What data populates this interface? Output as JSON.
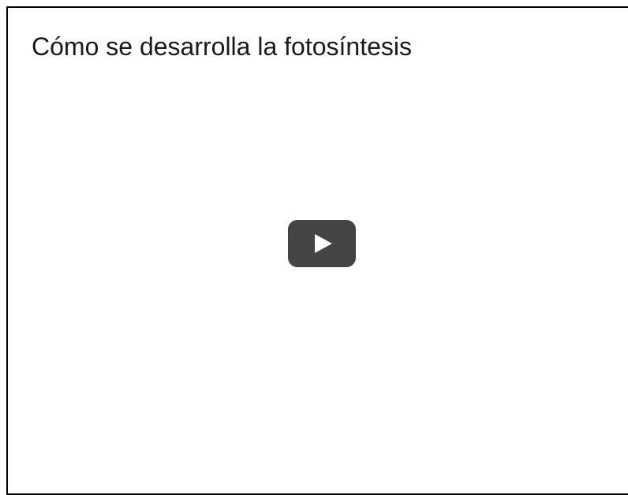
{
  "video": {
    "title": "Cómo se desarrolla la fotosíntesis",
    "play_icon": "play-icon",
    "play_button_color": "#444444"
  }
}
